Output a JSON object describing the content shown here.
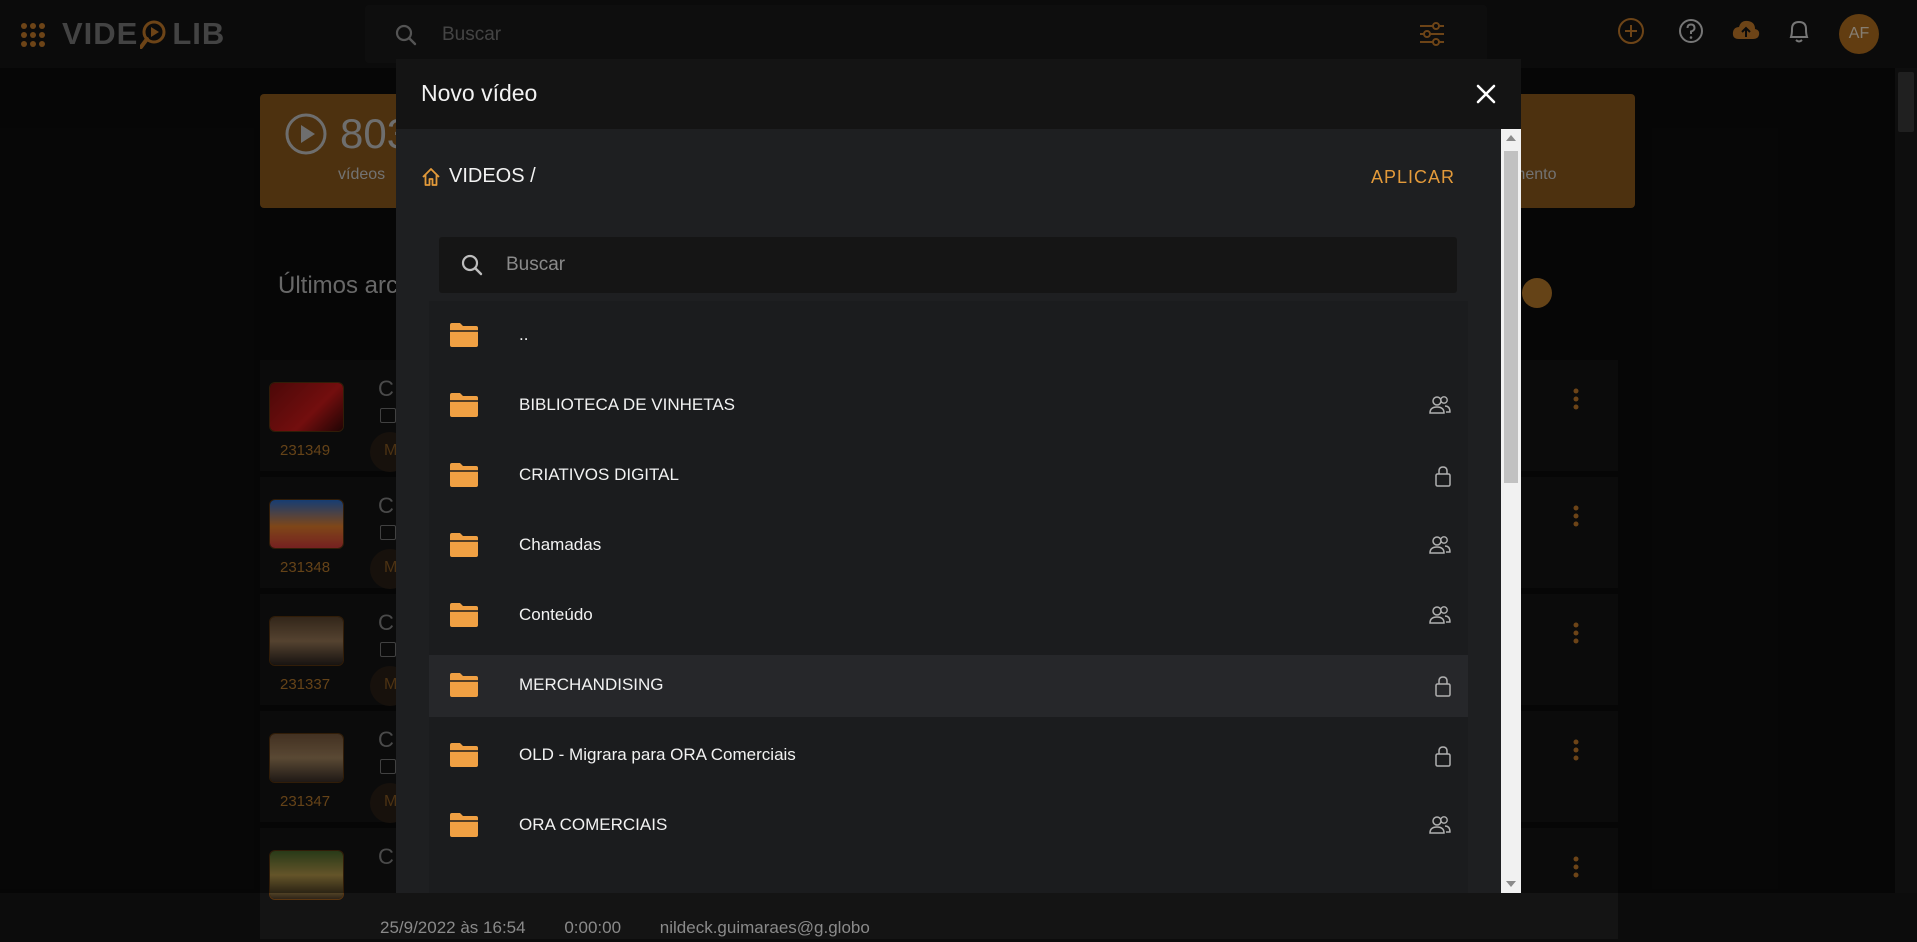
{
  "app": {
    "logo_text_left": "VIDE",
    "logo_text_right": "LIB",
    "avatar_initials": "AF"
  },
  "topbar": {
    "search_placeholder": "Buscar"
  },
  "stats": {
    "videos_count": "803",
    "videos_label": "vídeos",
    "right_label": "mento"
  },
  "section": {
    "title": "Últimos arc"
  },
  "background_rows": [
    {
      "code": "231349",
      "title_prefix": "C",
      "chip": "M"
    },
    {
      "code": "231348",
      "title_prefix": "C",
      "chip": "M"
    },
    {
      "code": "231337",
      "title_prefix": "C",
      "chip": "M"
    },
    {
      "code": "231347",
      "title_prefix": "C",
      "chip": "M"
    },
    {
      "code": "",
      "title_prefix": "C",
      "chip": "",
      "meta_date": "25/9/2022 às 16:54",
      "meta_duration": "0:00:00",
      "meta_user": "nildeck.guimaraes@g.globo"
    }
  ],
  "modal": {
    "title": "Novo vídeo",
    "breadcrumb": "VIDEOS /",
    "apply_label": "APLICAR",
    "search_placeholder": "Buscar",
    "folders": [
      {
        "name": "..",
        "access": "none"
      },
      {
        "name": "BIBLIOTECA DE VINHETAS",
        "access": "shared"
      },
      {
        "name": "CRIATIVOS DIGITAL",
        "access": "private"
      },
      {
        "name": "Chamadas",
        "access": "shared"
      },
      {
        "name": "Conteúdo",
        "access": "shared"
      },
      {
        "name": "MERCHANDISING",
        "access": "private"
      },
      {
        "name": "OLD - Migrara para ORA Comerciais",
        "access": "private"
      },
      {
        "name": "ORA COMERCIAIS",
        "access": "shared"
      }
    ],
    "selected_folder_index": 5
  },
  "colors": {
    "accent": "#e39a3a",
    "folder": "#f0a043",
    "brand_orange": "#b26f1f"
  },
  "icons": {
    "home": "home-icon",
    "folder": "folder-icon",
    "shared": "users-icon",
    "private": "lock-icon"
  }
}
